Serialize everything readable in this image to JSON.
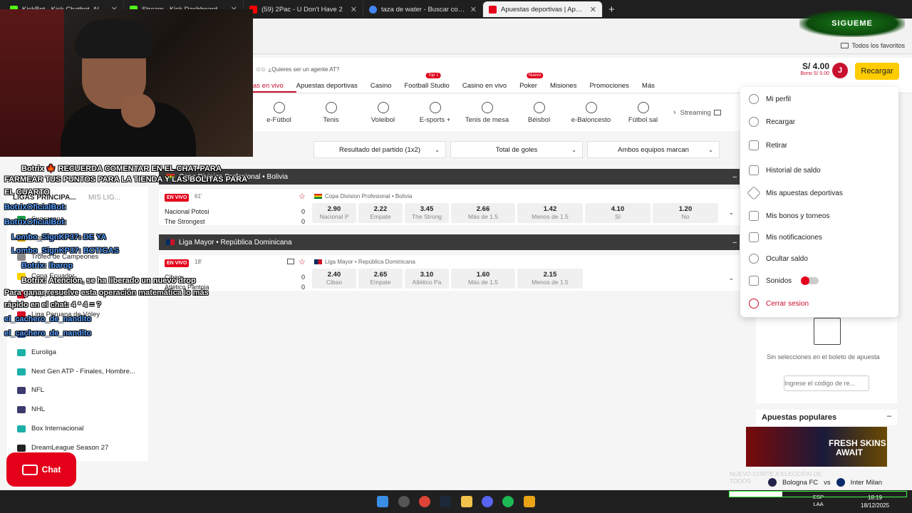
{
  "browser": {
    "tabs": [
      {
        "title": "KickBot - Kick Chatbot, Alerts, T",
        "color": "#53fc18"
      },
      {
        "title": "Stream - Kick Dashboard",
        "color": "#53fc18"
      },
      {
        "title": "(59) 2Pac - U Don't Have 2",
        "color": "#ff0000"
      },
      {
        "title": "taza de water - Buscar con Goo",
        "color": "#4285f4"
      },
      {
        "title": "Apuestas deportivas | Apuestas",
        "color": "#e4001b"
      }
    ],
    "bookmarks_folder": "Todos los favoritos"
  },
  "overlay": {
    "follow_badge": "SIGUEME",
    "chat_lines": [
      {
        "text": "Botrix 🍁 RECUERDA COMENTAR EN EL CHAT PARA",
        "kind": "w"
      },
      {
        "text": "FARMEAR TUS PUNTOS PARA LA TIENDA Y LAS BOLITAS PARA",
        "kind": "w"
      },
      {
        "text": "EL CUARTO",
        "kind": "w"
      },
      {
        "text": "BotrixOficialBot:",
        "kind": "u"
      },
      {
        "text": "BotrixOficialBot:",
        "kind": "u"
      },
      {
        "text": "Lombo_SignKP37: DE YA",
        "kind": "u"
      },
      {
        "text": "Lombo_SignKP37: BOTIGAS",
        "kind": "u"
      },
      {
        "text": "Botrix: Ibarop",
        "kind": "u"
      },
      {
        "text": "Botrix: Atención, se ha liberado un nuevo drop",
        "kind": "w"
      },
      {
        "text": "Para ganar resuelve esta operación matemática lo más",
        "kind": "w"
      },
      {
        "text": "rápido en el chat: 4 * 4 = ?",
        "kind": "w"
      },
      {
        "text": "el_cachero_de_nandito",
        "kind": "u"
      },
      {
        "text": "el_cachero_de_nandito",
        "kind": "u"
      }
    ],
    "score_popup": [
      "NUEVO CORTE A ELECCIÓN DE",
      "TODOS"
    ],
    "progress_fraction": 0.3
  },
  "site": {
    "promo": "¿Quieres ser un agente AT?",
    "balance": "S/ 4.00",
    "bonus": "Bono S/ 0.00",
    "avatar_initial": "J",
    "recargar": "Recargar",
    "nav": [
      {
        "label": "as en vivo",
        "active": true
      },
      {
        "label": "Apuestas deportivas"
      },
      {
        "label": "Casino"
      },
      {
        "label": "Football Studio",
        "badge": "Top 1"
      },
      {
        "label": "Casino en vivo"
      },
      {
        "label": "Poker",
        "badge": "Nuevo"
      },
      {
        "label": "Misiones"
      },
      {
        "label": "Promociones"
      },
      {
        "label": "Más"
      }
    ],
    "sports": [
      "e-Fútbol",
      "Tenis",
      "Voleibol",
      "E-sports +",
      "Tenis de mesa",
      "Béisbol",
      "e-Baloncesto",
      "Fútbol sal"
    ],
    "streaming": "Streaming",
    "filters": [
      "Resultado del partido (1x2)",
      "Total de goles",
      "Ambos equipos marcan"
    ]
  },
  "sidebar": {
    "title": "LIGAS PRINCIPA...",
    "title2": "MIS LIG...",
    "items": [
      {
        "label": "Supercopa",
        "color": "#1e9e4a"
      },
      {
        "label": "Copa Libertadores",
        "color": "#cca000"
      },
      {
        "label": "Trofeo de Campeones",
        "color": "#888"
      },
      {
        "label": "Copa Ecuador",
        "color": "#ffd100"
      },
      {
        "label": "Copa Perú",
        "color": "#d91023"
      },
      {
        "label": "Liga Peruana de Vóley",
        "color": "#d91023"
      },
      {
        "label": "NBA",
        "color": "#1d428a"
      },
      {
        "label": "Euroliga",
        "color": "#1bb0a8"
      },
      {
        "label": "Next Gen ATP - Finales, Hombre...",
        "color": "#1bb0a8"
      },
      {
        "label": "NFL",
        "color": "#3c3b6e"
      },
      {
        "label": "NHL",
        "color": "#3c3b6e"
      },
      {
        "label": "Box Internacional",
        "color": "#1bb0a8"
      },
      {
        "label": "DreamLeague Season 27",
        "color": "#222"
      }
    ],
    "chat_button": "Chat"
  },
  "events": [
    {
      "league": "Copa Division Profesional • Bolivia",
      "live": "EN VIVO",
      "minute": "61'",
      "sub_league": "Copa Division Profesional • Bolivia",
      "home": "Nacional Potosi",
      "away": "The Strongest",
      "score_home": "0",
      "score_away": "0",
      "odds": [
        {
          "v": "2.90",
          "l": "Nacional P"
        },
        {
          "v": "2.22",
          "l": "Empate"
        },
        {
          "v": "3.45",
          "l": "The Strong"
        },
        {
          "v": "2.66",
          "l": "Más de 1.5"
        },
        {
          "v": "1.42",
          "l": "Menos de 1.5"
        },
        {
          "v": "4.10",
          "l": "Sí"
        },
        {
          "v": "1.20",
          "l": "No"
        }
      ]
    },
    {
      "league": "Liga Mayor • República Dominicana",
      "live": "EN VIVO",
      "minute": "18'",
      "sub_league": "Liga Mayor • República Dominicana",
      "home": "Cibao",
      "away": "Atlético Pantoja",
      "score_home": "0",
      "score_away": "0",
      "odds": [
        {
          "v": "2.40",
          "l": "Cibao"
        },
        {
          "v": "2.65",
          "l": "Empate"
        },
        {
          "v": "3.10",
          "l": "Atlético Pa"
        },
        {
          "v": "1.60",
          "l": "Más de 1.5"
        },
        {
          "v": "2.15",
          "l": "Menos de 1.5"
        }
      ]
    }
  ],
  "menu": [
    "Mi perfil",
    "Recargar",
    "Retirar",
    "Historial de saldo",
    "Mis apuestas deportivas",
    "Mis bonos y torneos",
    "Mis notificaciones",
    "Ocultar saldo",
    "Sonidos",
    "Cerrar sesion"
  ],
  "betslip": {
    "empty_text": "Sin selecciones en el boleto de apuesta",
    "code_placeholder": "Ingrese el código de re..."
  },
  "popular": {
    "title": "Apuestas populares",
    "banner_line1": "FRESH SKINS",
    "banner_line2": "AWAIT",
    "next_home": "Bologna FC",
    "vs": "vs",
    "next_away": "Inter Milan"
  },
  "taskbar": {
    "lang1": "ESP",
    "lang2": "LAA",
    "time": "18:19",
    "date": "18/12/2025"
  }
}
